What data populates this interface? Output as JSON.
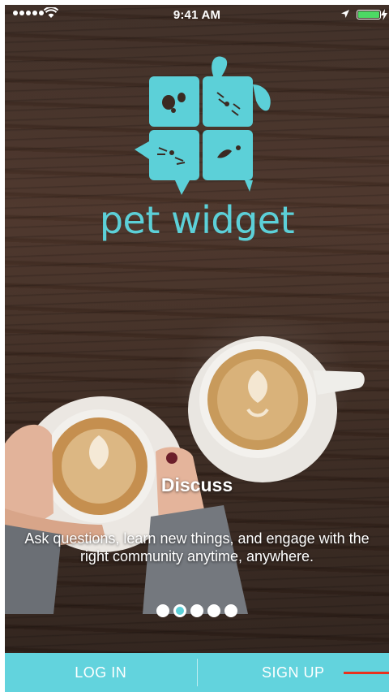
{
  "status_bar": {
    "time": "9:41 AM",
    "icons": [
      "signal-dots-icon",
      "wifi-icon",
      "location-arrow-icon",
      "battery-icon",
      "charging-bolt-icon"
    ]
  },
  "brand": {
    "name": "pet widget",
    "accent_color": "#5cd0d8"
  },
  "slide": {
    "title": "Discuss",
    "description": "Ask questions, learn new things, and engage with the right community anytime, anywhere.",
    "active_index": 1,
    "total": 5
  },
  "actions": {
    "login_label": "LOG IN",
    "signup_label": "SIGN UP",
    "bar_color": "#62d3dd"
  }
}
